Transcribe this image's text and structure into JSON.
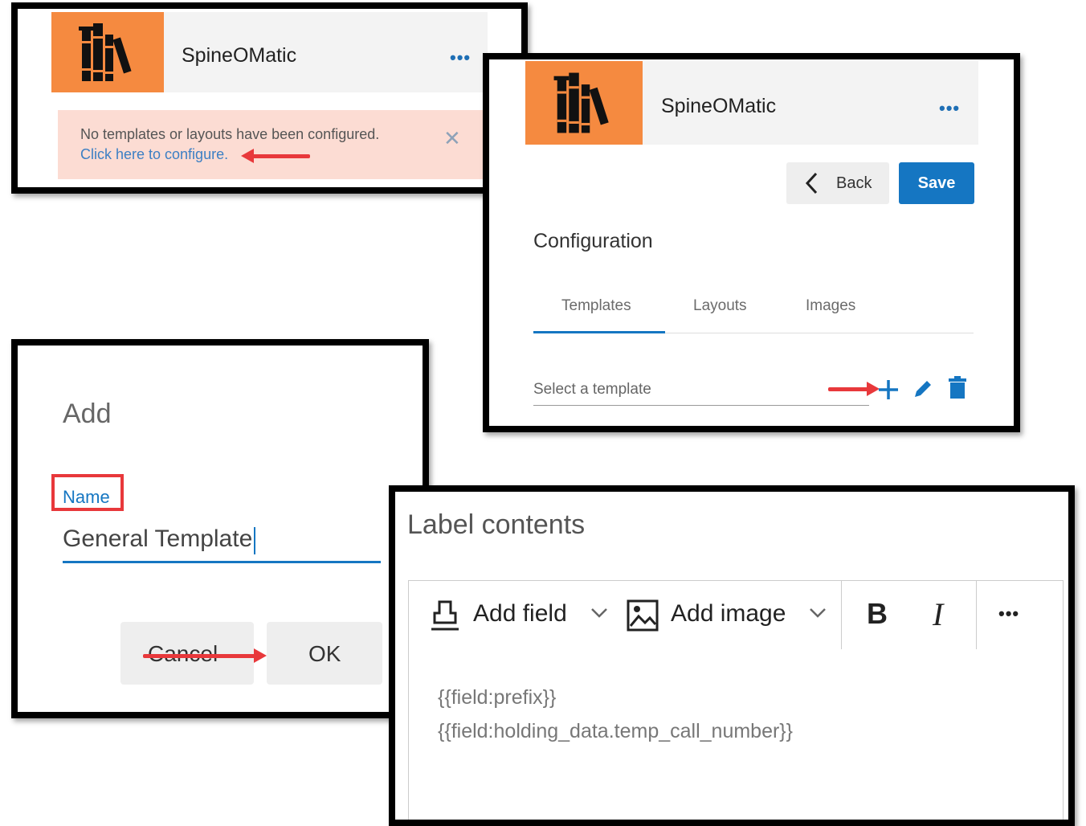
{
  "app": {
    "title": "SpineOMatic",
    "more_label": "•••"
  },
  "alert": {
    "message": "No templates or layouts have been configured.",
    "link": "Click here to configure.",
    "close": "✕"
  },
  "config": {
    "back_label": "Back",
    "save_label": "Save",
    "heading": "Configuration",
    "tabs": [
      {
        "label": "Templates",
        "active": true
      },
      {
        "label": "Layouts",
        "active": false
      },
      {
        "label": "Images",
        "active": false
      }
    ],
    "select_placeholder": "Select a template"
  },
  "add_dialog": {
    "title": "Add",
    "name_label": "Name",
    "name_value": "General Template",
    "cancel_label": "Cancel",
    "ok_label": "OK"
  },
  "label_editor": {
    "title": "Label contents",
    "add_field_label": "Add field",
    "add_image_label": "Add image",
    "bold_label": "B",
    "italic_label": "I",
    "more_label": "•••",
    "lines": [
      "{{field:prefix}}",
      "{{field:holding_data.temp_call_number}}"
    ]
  },
  "colors": {
    "accent": "#1576c2",
    "logo_bg": "#f58a40",
    "alert_bg": "#fcdcd3",
    "annotation": "#e8383b"
  }
}
